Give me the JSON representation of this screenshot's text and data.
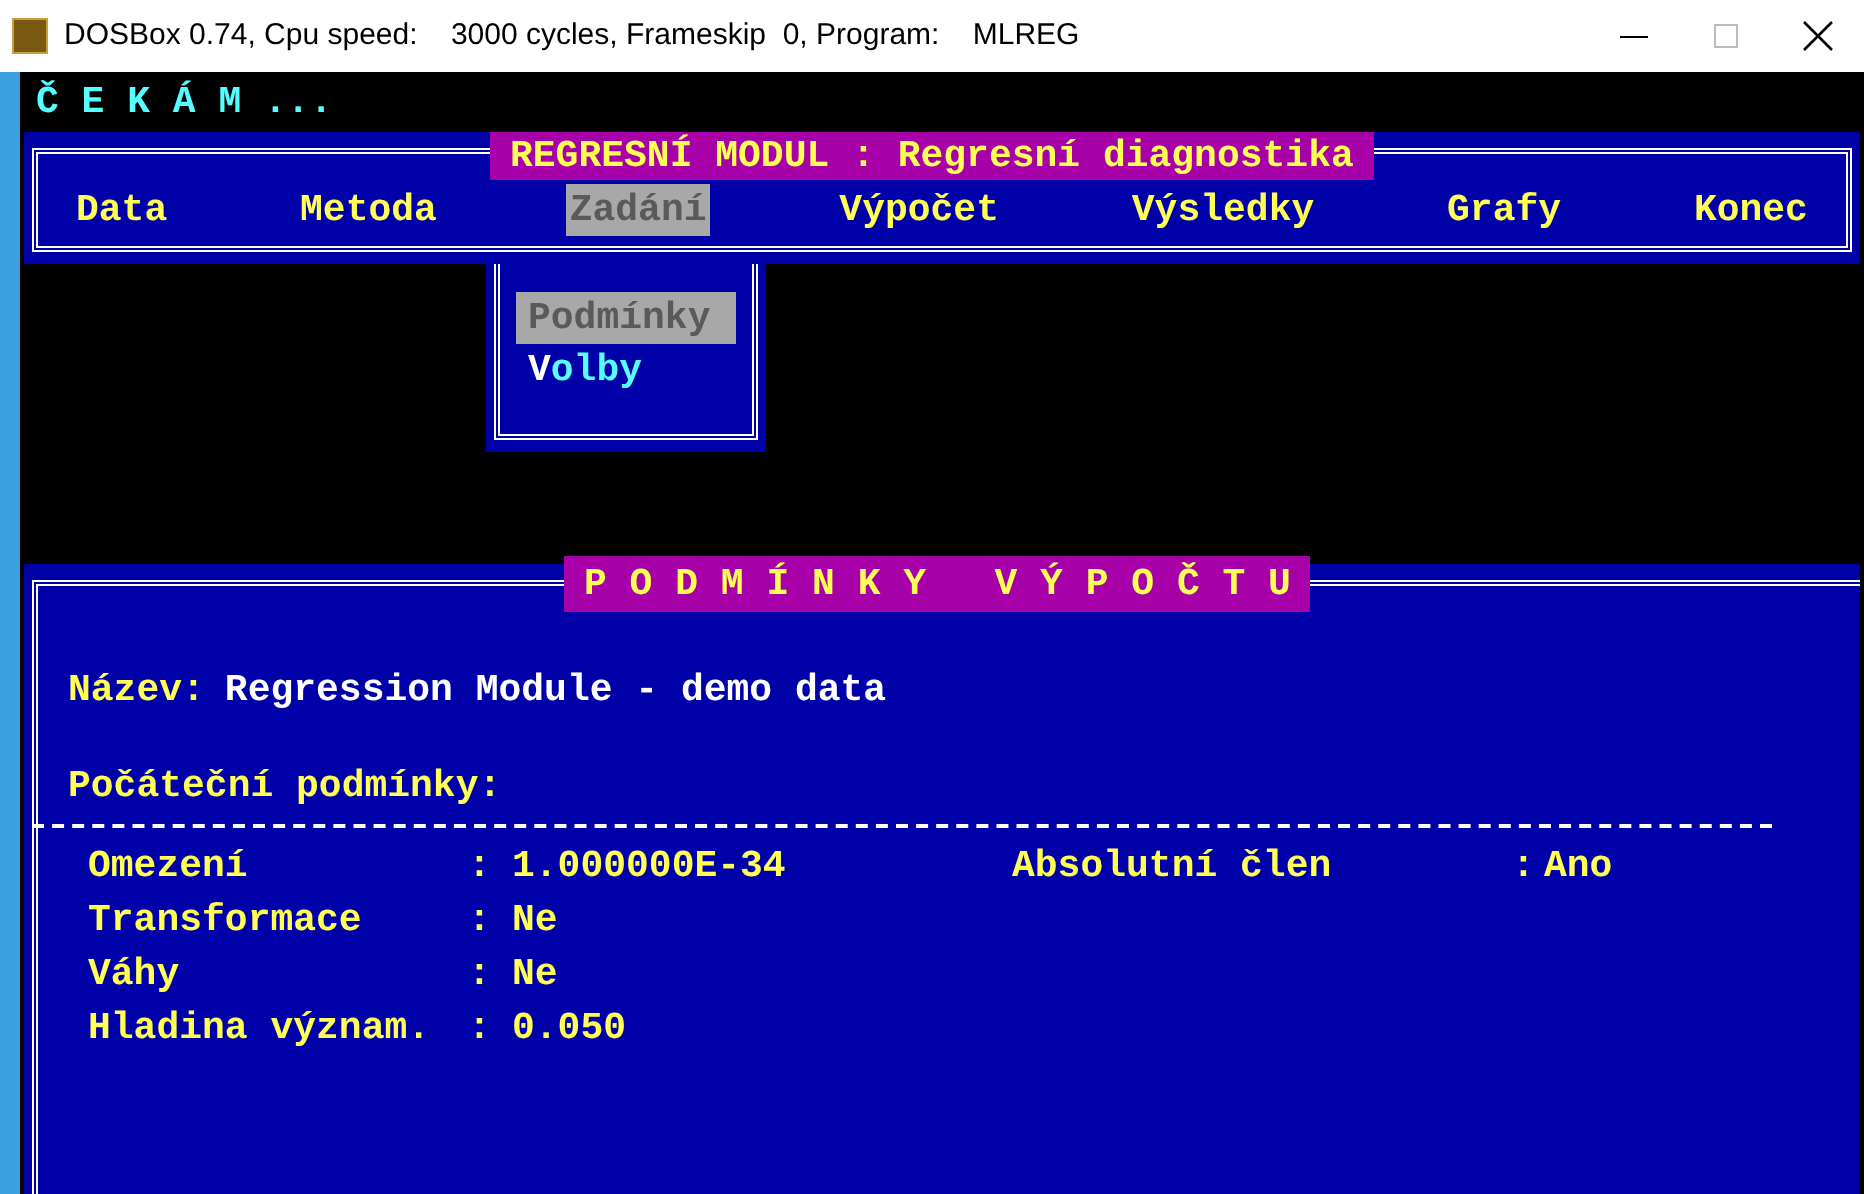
{
  "window": {
    "title": "DOSBox 0.74, Cpu speed:    3000 cycles, Frameskip  0, Program:    MLREG"
  },
  "status": "Č E K Á M ...",
  "menu_panel": {
    "title": "REGRESNÍ MODUL : Regresní diagnostika",
    "items": [
      {
        "label": "Data",
        "selected": false
      },
      {
        "label": "Metoda",
        "selected": false
      },
      {
        "label": "Zadání",
        "selected": true
      },
      {
        "label": "Výpočet",
        "selected": false
      },
      {
        "label": "Výsledky",
        "selected": false
      },
      {
        "label": "Grafy",
        "selected": false
      },
      {
        "label": "Konec",
        "selected": false
      }
    ]
  },
  "dropdown": [
    {
      "label": "Podmínky",
      "selected": true
    },
    {
      "label": "Volby",
      "selected": false
    }
  ],
  "conditions_panel": {
    "title": "P O D M Í N K Y   V Ý P O Č T U",
    "name_label": "Název:",
    "name_value": "Regression Module - demo data",
    "section_label": "Počáteční podmínky:",
    "params": [
      {
        "label": "Omezení",
        "separator": ":",
        "value": "1.000000E-34"
      },
      {
        "label": "Transformace",
        "separator": ":",
        "value": "Ne"
      },
      {
        "label": "Váhy",
        "separator": ":",
        "value": "Ne"
      },
      {
        "label": "Hladina význam.",
        "separator": ":",
        "value": "0.050"
      }
    ],
    "side_param": {
      "label": "Absolutní člen",
      "separator": ":",
      "value": "Ano"
    }
  }
}
